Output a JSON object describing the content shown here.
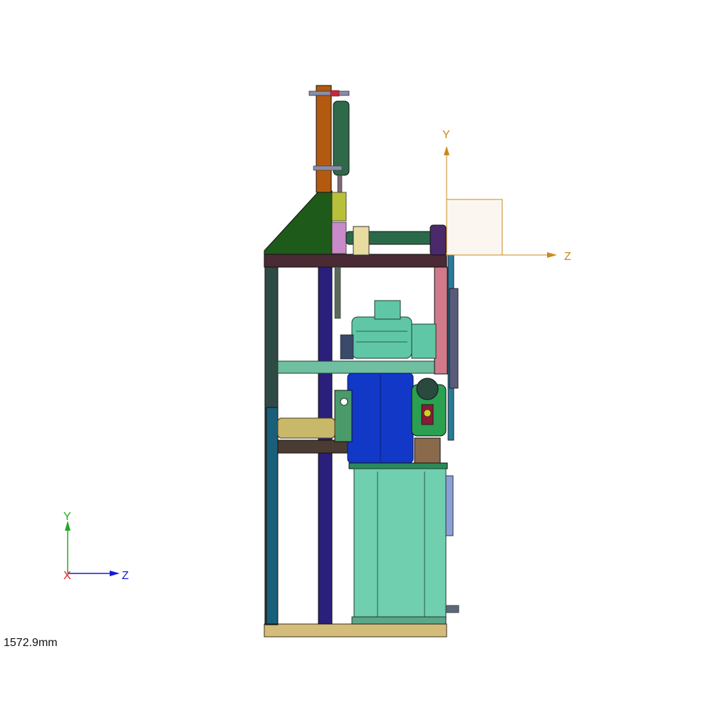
{
  "view": {
    "scale_readout": "1572.9mm"
  },
  "triad": {
    "y_label": "Y",
    "z_label": "Z",
    "x_label": "X",
    "y_color": "#22aa22",
    "z_color": "#1a1ad6",
    "x_color": "#dd2222"
  },
  "coord_system": {
    "y_label": "Y",
    "z_label": "Z",
    "color": "#c98a1a"
  },
  "colors": {
    "frame_top": "#4a2a35",
    "frame_post": "#2f4a45",
    "base": "#d4bd7a",
    "tank": "#6fcfae",
    "blue_motor": "#1238c8",
    "green_motor": "#5fc7a5",
    "gusset": "#1e5a1a",
    "orange_bar": "#b35a10",
    "chain": "#2a7a9a",
    "purple_rail": "#2a1f7a"
  }
}
